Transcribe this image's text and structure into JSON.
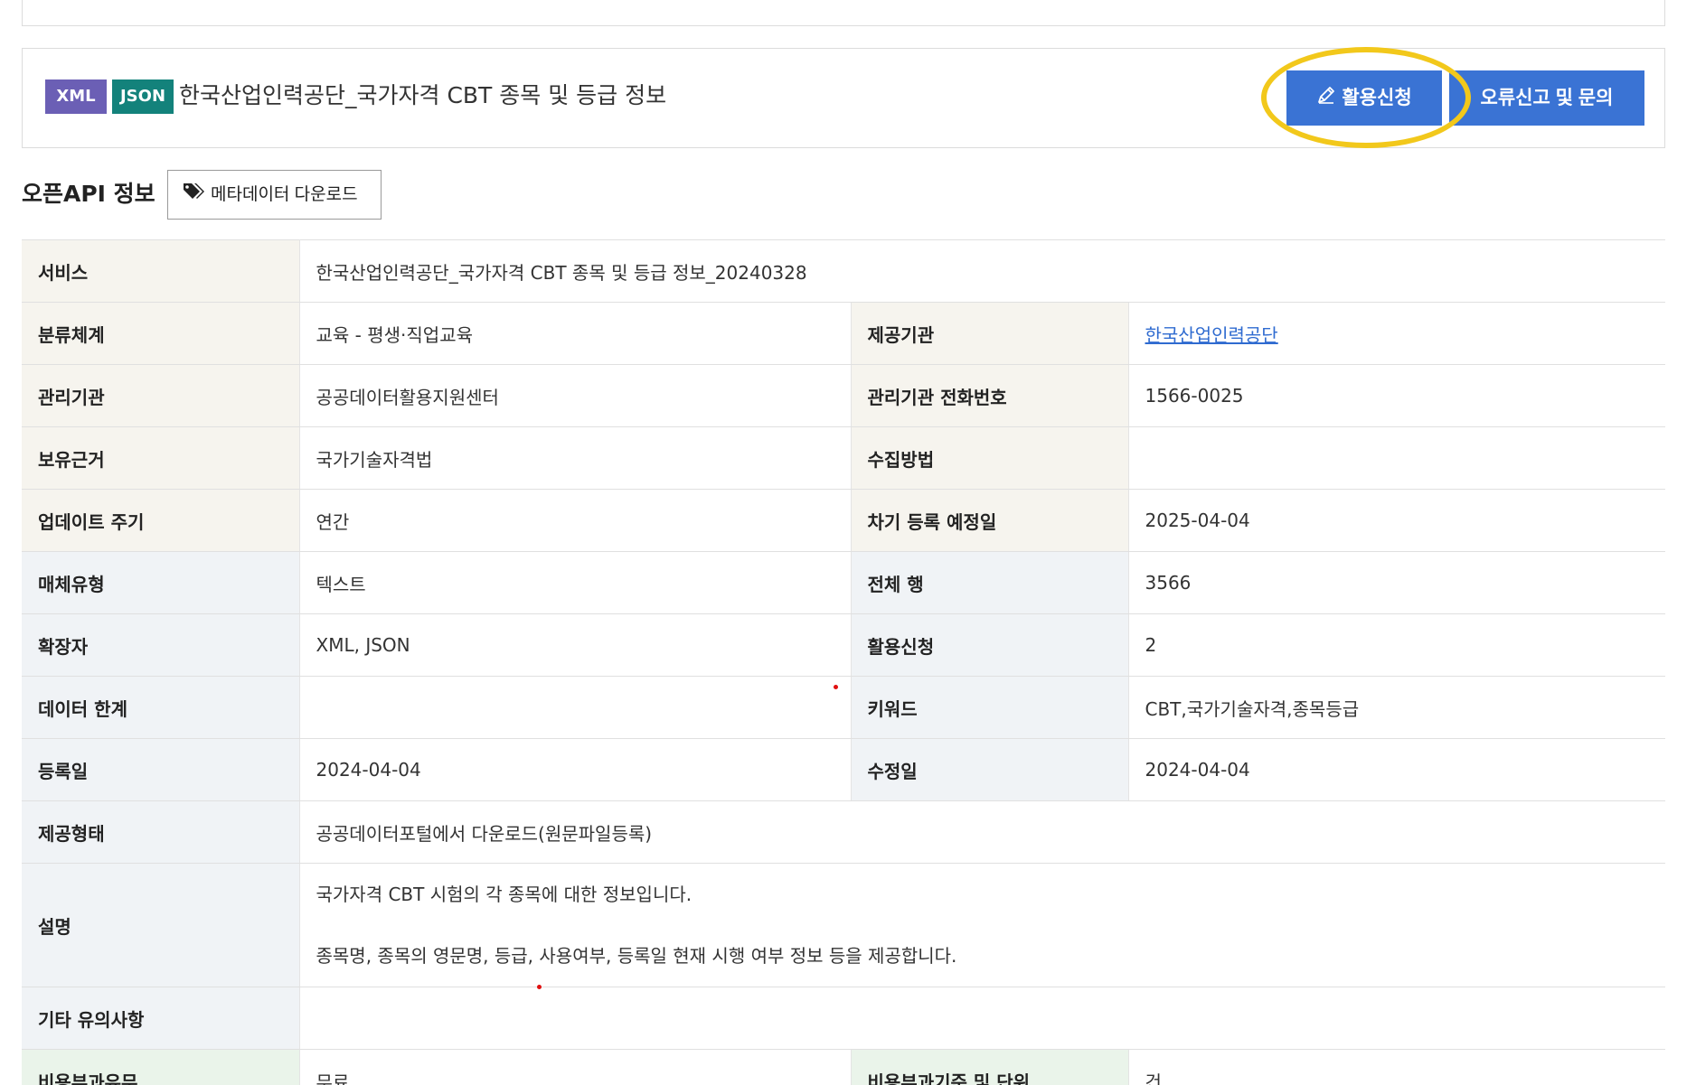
{
  "header": {
    "badges": [
      "XML",
      "JSON"
    ],
    "dataset_title": "한국산업인력공단_국가자격 CBT 종목 및 등급 정보",
    "apply_label": "활용신청",
    "report_label": "오류신고 및 문의",
    "accent_color": "#3a73d4",
    "highlight_color": "#f2c81b"
  },
  "section": {
    "title": "오픈API 정보",
    "metadata_download_label": "메타데이터 다운로드"
  },
  "info": {
    "service_label": "서비스",
    "service_value": "한국산업인력공단_국가자격 CBT 종목 및 등급 정보_20240328",
    "category_label": "분류체계",
    "category_value": "교육 - 평생·직업교육",
    "provider_label": "제공기관",
    "provider_value": "한국산업인력공단",
    "manager_label": "관리기관",
    "manager_value": "공공데이터활용지원센터",
    "manager_phone_label": "관리기관 전화번호",
    "manager_phone_value": "1566-0025",
    "basis_label": "보유근거",
    "basis_value": "국가기술자격법",
    "collect_label": "수집방법",
    "collect_value": "",
    "update_label": "업데이트 주기",
    "update_value": "연간",
    "next_reg_label": "차기 등록 예정일",
    "next_reg_value": "2025-04-04",
    "media_label": "매체유형",
    "media_value": "텍스트",
    "rows_label": "전체 행",
    "rows_value": "3566",
    "ext_label": "확장자",
    "ext_value": "XML, JSON",
    "apply_count_label": "활용신청",
    "apply_count_value": "2",
    "limit_label": "데이터 한계",
    "limit_value": "",
    "keyword_label": "키워드",
    "keyword_value": "CBT,국가기술자격,종목등급",
    "reg_date_label": "등록일",
    "reg_date_value": "2024-04-04",
    "mod_date_label": "수정일",
    "mod_date_value": "2024-04-04",
    "provide_type_label": "제공형태",
    "provide_type_value": "공공데이터포털에서 다운로드(원문파일등록)",
    "desc_label": "설명",
    "desc_line1": "국가자격 CBT 시험의 각 종목에 대한 정보입니다.",
    "desc_line2": "종목명, 종목의 영문명, 등급, 사용여부, 등록일 현재 시행 여부 정보 등을 제공합니다.",
    "etc_label": "기타 유의사항",
    "etc_value": "",
    "fee_label": "비용부과유무",
    "fee_value": "무료",
    "fee_basis_label": "비용부과기준 및 단위",
    "fee_basis_value": "건"
  }
}
